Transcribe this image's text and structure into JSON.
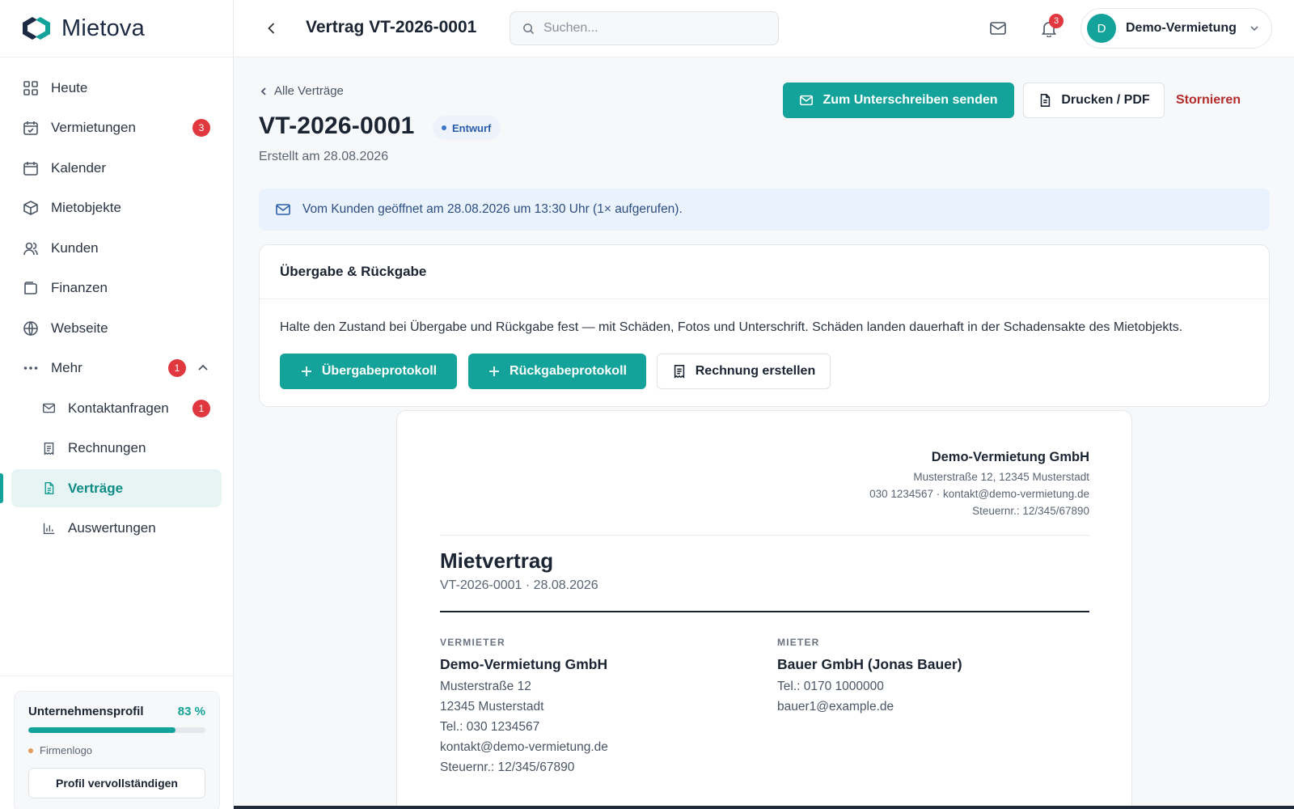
{
  "brand": {
    "name": "Mietova",
    "accent": "#14a39a"
  },
  "sidebar": {
    "items": [
      {
        "label": "Heute",
        "icon": "grid-icon"
      },
      {
        "label": "Vermietungen",
        "icon": "calendar-check-icon",
        "badge": "3"
      },
      {
        "label": "Kalender",
        "icon": "calendar-icon"
      },
      {
        "label": "Mietobjekte",
        "icon": "box-icon"
      },
      {
        "label": "Kunden",
        "icon": "users-icon"
      },
      {
        "label": "Finanzen",
        "icon": "wallet-icon"
      },
      {
        "label": "Webseite",
        "icon": "globe-icon"
      },
      {
        "label": "Mehr",
        "icon": "dots-icon",
        "badge": "1"
      }
    ],
    "subitems": [
      {
        "label": "Kontaktanfragen",
        "icon": "mail-icon",
        "badge": "1"
      },
      {
        "label": "Rechnungen",
        "icon": "receipt-icon"
      },
      {
        "label": "Verträge",
        "icon": "contract-icon",
        "active": true
      },
      {
        "label": "Auswertungen",
        "icon": "chart-icon"
      }
    ],
    "profile": {
      "title": "Unternehmensprofil",
      "percent_label": "83 %",
      "progress": 0.83,
      "todo": "Firmenlogo",
      "button": "Profil vervollständigen"
    }
  },
  "topbar": {
    "title": "Vertrag VT-2026-0001",
    "search_placeholder": "Suchen...",
    "notification_count": "3",
    "account_initial": "D",
    "account_name": "Demo-Vermietung"
  },
  "header": {
    "breadcrumb": "Alle Verträge",
    "title": "VT-2026-0001",
    "status": "Entwurf",
    "created": "Erstellt am 28.08.2026",
    "send_button": "Zum Unterschreiben senden",
    "print_button": "Drucken / PDF",
    "cancel_button": "Stornieren"
  },
  "banner": {
    "text": "Vom Kunden geöffnet am 28.08.2026 um 13:30 Uhr (1× aufgerufen)."
  },
  "handover": {
    "title": "Übergabe & Rückgabe",
    "description": "Halte den Zustand bei Übergabe und Rückgabe fest — mit Schäden, Fotos und Unterschrift. Schäden landen dauerhaft in der Schadensakte des Mietobjekts.",
    "btn_handover": "Übergabeprotokoll",
    "btn_return": "Rückgabeprotokoll",
    "btn_invoice": "Rechnung erstellen"
  },
  "document": {
    "company_name": "Demo-Vermietung GmbH",
    "company_lines": [
      "Musterstraße 12, 12345 Musterstadt",
      "030 1234567 · kontakt@demo-vermietung.de",
      "Steuernr.: 12/345/67890"
    ],
    "title": "Mietvertrag",
    "subtitle": "VT-2026-0001 · 28.08.2026",
    "landlord": {
      "label": "VERMIETER",
      "name": "Demo-Vermietung GmbH",
      "lines": [
        "Musterstraße 12",
        "12345 Musterstadt",
        "Tel.: 030 1234567",
        "kontakt@demo-vermietung.de",
        "Steuernr.: 12/345/67890"
      ]
    },
    "tenant": {
      "label": "MIETER",
      "name": "Bauer GmbH (Jonas Bauer)",
      "lines": [
        "Tel.: 0170 1000000",
        "bauer1@example.de"
      ]
    }
  }
}
